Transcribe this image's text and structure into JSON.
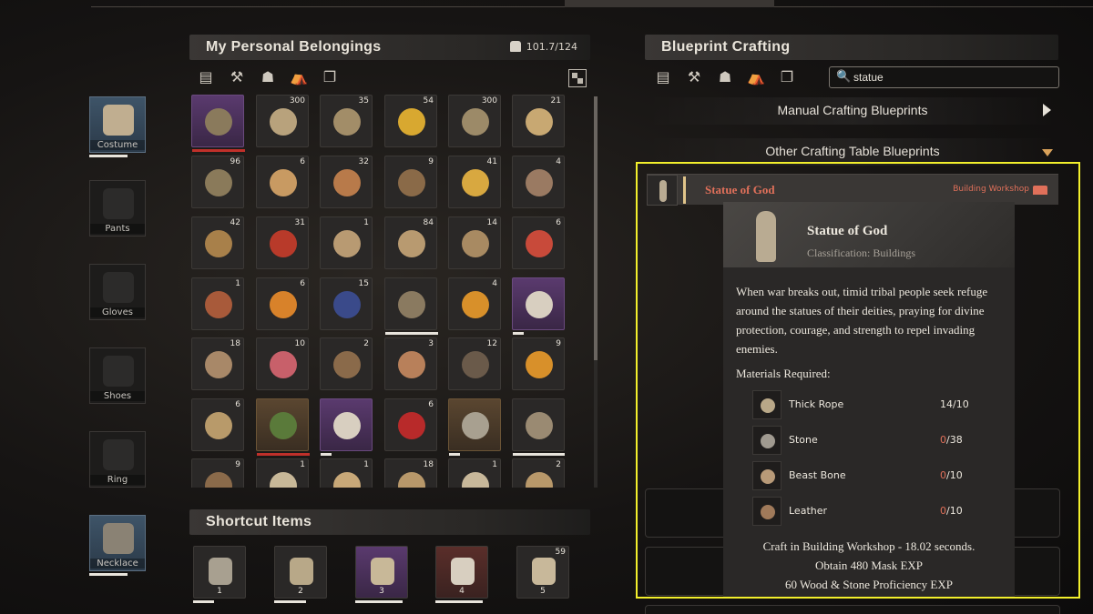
{
  "equipment": [
    {
      "label": "Costume",
      "filled": true
    },
    {
      "label": "Pants",
      "filled": false
    },
    {
      "label": "Gloves",
      "filled": false
    },
    {
      "label": "Shoes",
      "filled": false
    },
    {
      "label": "Ring",
      "filled": false
    },
    {
      "label": "Necklace",
      "filled": true
    }
  ],
  "inventory": {
    "title": "My Personal Belongings",
    "weight": "101.7/124",
    "filters": [
      "ingots-icon",
      "tools-icon",
      "armor-icon",
      "tent-icon",
      "stack-icon"
    ],
    "items": [
      {
        "count": "",
        "color": "#8a7a5c",
        "rarity": "purple",
        "durability": 1.0,
        "durability_color": "red"
      },
      {
        "count": "300",
        "color": "#b8a27c"
      },
      {
        "count": "35",
        "color": "#a28d68"
      },
      {
        "count": "54",
        "color": "#d8a830"
      },
      {
        "count": "300",
        "color": "#9c8a68"
      },
      {
        "count": "21",
        "color": "#c8a872"
      },
      {
        "count": "96",
        "color": "#8a7a5a"
      },
      {
        "count": "6",
        "color": "#c89a62"
      },
      {
        "count": "32",
        "color": "#b87a4a"
      },
      {
        "count": "9",
        "color": "#8a6a48"
      },
      {
        "count": "41",
        "color": "#d8a840"
      },
      {
        "count": "4",
        "color": "#9a7a62"
      },
      {
        "count": "42",
        "color": "#a8804a"
      },
      {
        "count": "31",
        "color": "#b83a2a"
      },
      {
        "count": "1",
        "color": "#b89a72"
      },
      {
        "count": "84",
        "color": "#b89a70"
      },
      {
        "count": "14",
        "color": "#a88a62"
      },
      {
        "count": "6",
        "color": "#c84a3a"
      },
      {
        "count": "1",
        "color": "#a85a3a"
      },
      {
        "count": "6",
        "color": "#d8822a"
      },
      {
        "count": "15",
        "color": "#3a4a8a"
      },
      {
        "count": "",
        "color": "#8a7a60",
        "durability": 1.0
      },
      {
        "count": "4",
        "color": "#d8902a"
      },
      {
        "count": "",
        "color": "#d8cfc0",
        "rarity": "purple",
        "durability": 0.2
      },
      {
        "count": "18",
        "color": "#a88868"
      },
      {
        "count": "10",
        "color": "#c8606a"
      },
      {
        "count": "2",
        "color": "#8a6a4a"
      },
      {
        "count": "3",
        "color": "#b8805a"
      },
      {
        "count": "12",
        "color": "#6a5a4a"
      },
      {
        "count": "9",
        "color": "#d8902a"
      },
      {
        "count": "6",
        "color": "#b89a6a"
      },
      {
        "count": "",
        "color": "#5a7a3a",
        "rarity": "gold",
        "durability": 1.0,
        "durability_color": "red"
      },
      {
        "count": "",
        "color": "#d8cfc0",
        "rarity": "purple",
        "durability": 0.2
      },
      {
        "count": "6",
        "color": "#b82a2a"
      },
      {
        "count": "",
        "color": "#a8a090",
        "rarity": "gold",
        "durability": 0.2
      },
      {
        "count": "",
        "color": "#9a8a72",
        "durability": 1.0
      },
      {
        "count": "9",
        "color": "#8a6a4a"
      },
      {
        "count": "1",
        "color": "#c8b898"
      },
      {
        "count": "1",
        "color": "#c8a878"
      },
      {
        "count": "18",
        "color": "#b8986a"
      },
      {
        "count": "1",
        "color": "#c8b89a"
      },
      {
        "count": "2",
        "color": "#b8986a"
      }
    ]
  },
  "shortcut": {
    "title": "Shortcut Items",
    "items": [
      {
        "num": "1",
        "count": "",
        "color": "#a8a090",
        "bg": "",
        "durability": 0.4
      },
      {
        "num": "2",
        "count": "",
        "color": "#b8a888",
        "bg": "",
        "durability": 0.6
      },
      {
        "num": "3",
        "count": "",
        "color": "#c8b898",
        "bg": "purple",
        "durability": 0.9
      },
      {
        "num": "4",
        "count": "",
        "color": "#d8cfc0",
        "bg": "red",
        "durability": 0.9
      },
      {
        "num": "5",
        "count": "59",
        "color": "#c8b89a",
        "bg": "",
        "durability": 0
      }
    ]
  },
  "blueprint": {
    "title": "Blueprint Crafting",
    "filters": [
      "ingots-icon",
      "tools-icon",
      "armor-icon",
      "tent-icon",
      "stack-icon"
    ],
    "search_icon": "🔍",
    "search_value": "statue",
    "manual_section": "Manual Crafting Blueprints",
    "other_section": "Other Crafting Table Blueprints",
    "selected": {
      "name": "Statue of God",
      "workshop": "Building Workshop",
      "workshop_color": "#e0705a"
    }
  },
  "tooltip": {
    "title": "Statue of God",
    "classification": "Classification: Buildings",
    "description": "When war breaks out, timid tribal people seek refuge around the statues of their deities, praying for divine protection, courage, and strength to repel invading enemies.",
    "materials_label": "Materials Required:",
    "materials": [
      {
        "name": "Thick Rope",
        "have": "14",
        "need": "/10",
        "zero": false
      },
      {
        "name": "Stone",
        "have": "0",
        "need": "/38",
        "zero": true
      },
      {
        "name": "Beast Bone",
        "have": "0",
        "need": "/10",
        "zero": true
      },
      {
        "name": "Leather",
        "have": "0",
        "need": "/10",
        "zero": true
      }
    ],
    "craft_line": "Craft in Building Workshop - 18.02 seconds.",
    "exp_line": "Obtain 480 Mask EXP",
    "prof_line": "60 Wood & Stone Proficiency EXP"
  }
}
